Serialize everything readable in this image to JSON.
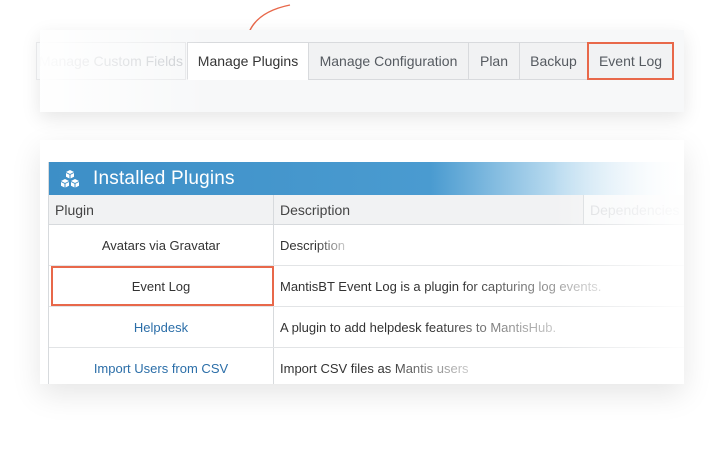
{
  "tabs": [
    {
      "label": "Manage Custom Fields",
      "state": "faded"
    },
    {
      "label": "Manage Plugins",
      "state": "active"
    },
    {
      "label": "Manage Configuration",
      "state": "normal"
    },
    {
      "label": "Plan",
      "state": "normal"
    },
    {
      "label": "Backup",
      "state": "normal"
    },
    {
      "label": "Event Log",
      "state": "highlighted"
    }
  ],
  "panel": {
    "title": "Installed Plugins",
    "icon": "cubes-icon",
    "columns": [
      "Plugin",
      "Description",
      "Dependencies"
    ],
    "rows": [
      {
        "plugin": "Avatars via Gravatar",
        "description": "Description",
        "link": false
      },
      {
        "plugin": "Event Log",
        "description": "MantisBT Event Log is a plugin for capturing log events.",
        "link": false,
        "highlighted": true
      },
      {
        "plugin": "Helpdesk",
        "description": "A plugin to add helpdesk features to MantisHub.",
        "link": true
      },
      {
        "plugin": "Import Users from CSV",
        "description": "Import CSV files as Mantis users",
        "link": true
      }
    ]
  },
  "colors": {
    "accent": "#e8684a",
    "header_blue": "#3d8fc7",
    "link": "#2b6ea8"
  }
}
